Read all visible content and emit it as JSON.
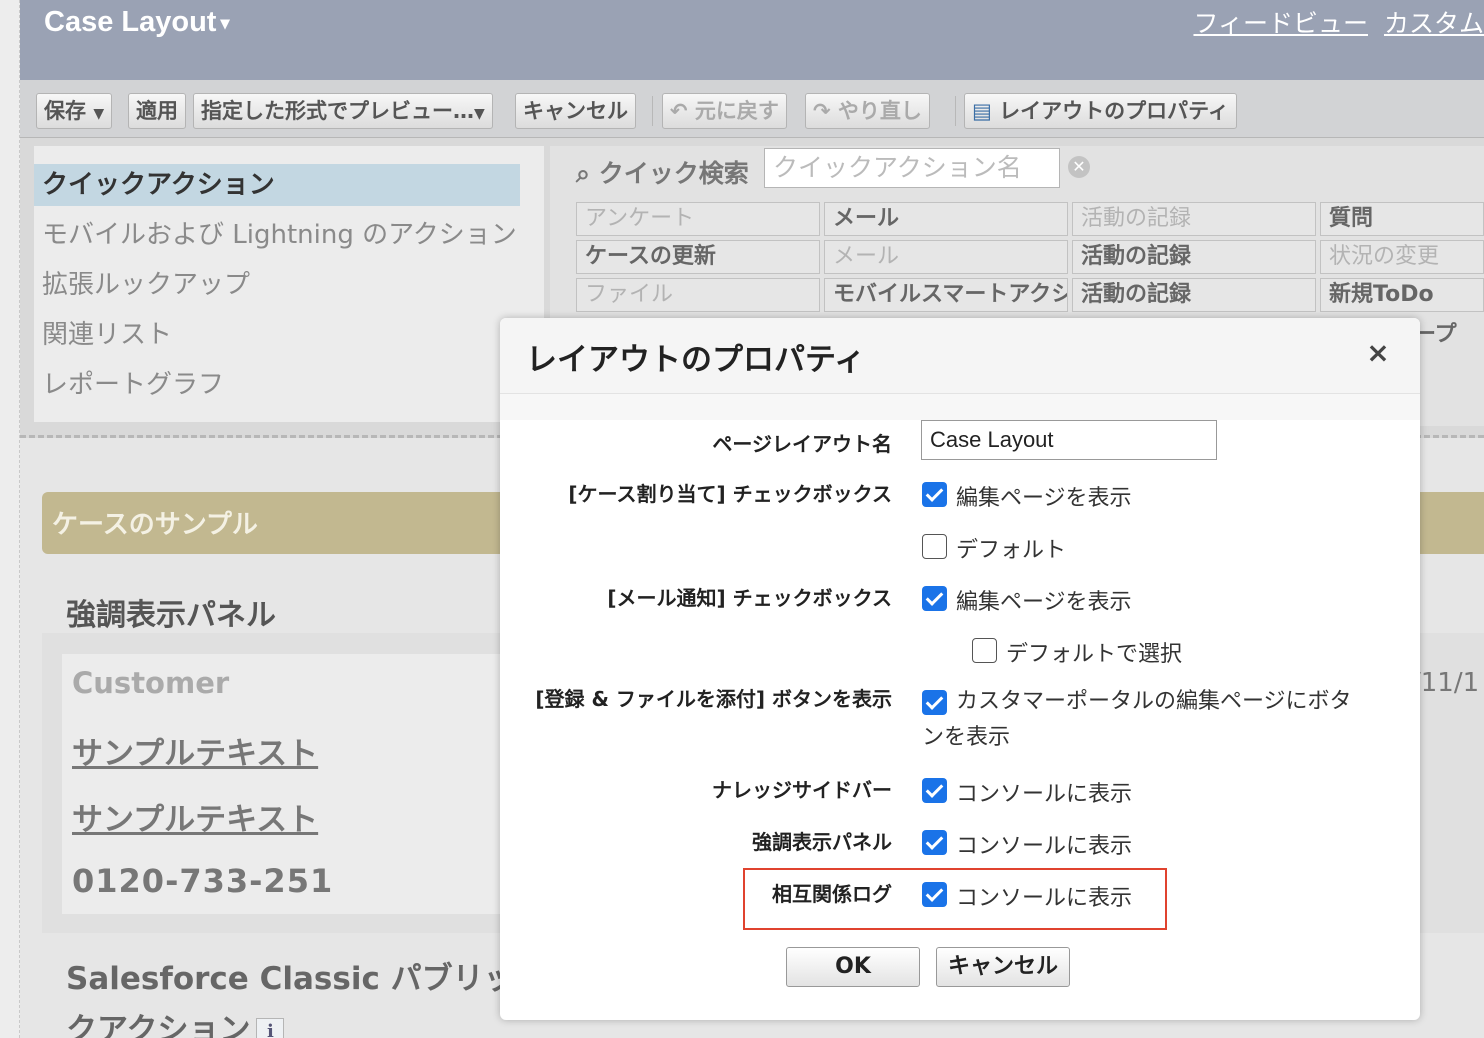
{
  "header": {
    "title": "Case Layout",
    "links": [
      "フィードビュー",
      "カスタム"
    ]
  },
  "toolbar": {
    "save": "保存",
    "apply": "適用",
    "preview": "指定した形式でプレビュー…",
    "cancel": "キャンセル",
    "undo": "元に戻す",
    "redo": "やり直し",
    "properties": "レイアウトのプロパティ"
  },
  "palette": {
    "nav": [
      "クイックアクション",
      "モバイルおよび Lightning のアクション",
      "拡張ルックアップ",
      "関連リスト",
      "レポートグラフ"
    ],
    "quick_search_label": "クイック検索",
    "quick_search_placeholder": "クイックアクション名",
    "grid": [
      [
        "アンケート",
        "メール",
        "活動の記録",
        "質問"
      ],
      [
        "ケースの更新",
        "メール",
        "活動の記録",
        "状況の変更"
      ],
      [
        "ファイル",
        "モバイルスマートアクション",
        "活動の記録",
        "新規ToDo"
      ]
    ],
    "partial_text": "ープ"
  },
  "background": {
    "section_title": "ケースのサンプル",
    "highlight_title": "強調表示パネル",
    "customer": "Customer",
    "sample_1": "サンプルテキスト",
    "sample_2": "サンプルテキスト",
    "phone": "0120-733-251",
    "date_fragment": "/11/1",
    "classic_title": "Salesforce Classic パブリッ",
    "classic_title2": "クアクション"
  },
  "modal": {
    "title": "レイアウトのプロパティ",
    "fields": {
      "layout_name_label": "ページレイアウト名",
      "layout_name_value": "Case Layout",
      "case_assign_label": "[ケース割り当て] チェックボックス",
      "case_assign_show": "編集ページを表示",
      "case_assign_default": "デフォルト",
      "email_notify_label": "[メール通知] チェックボックス",
      "email_notify_show": "編集ページを表示",
      "email_notify_default": "デフォルトで選択",
      "attach_label": "[登録 & ファイルを添付] ボタンを表示",
      "attach_text": "カスタマーポータルの編集ページにボタンを表示",
      "knowledge_label": "ナレッジサイドバー",
      "knowledge_text": "コンソールに表示",
      "highlight_label": "強調表示パネル",
      "highlight_text": "コンソールに表示",
      "interaction_label": "相互関係ログ",
      "interaction_text": "コンソールに表示"
    },
    "ok": "OK",
    "cancel": "キャンセル"
  },
  "colors": {
    "checkbox_checked": "#1a73e8",
    "highlight_outline": "#e0432f",
    "header_bar": "#9aa2b4",
    "section_header": "#c2b890"
  }
}
